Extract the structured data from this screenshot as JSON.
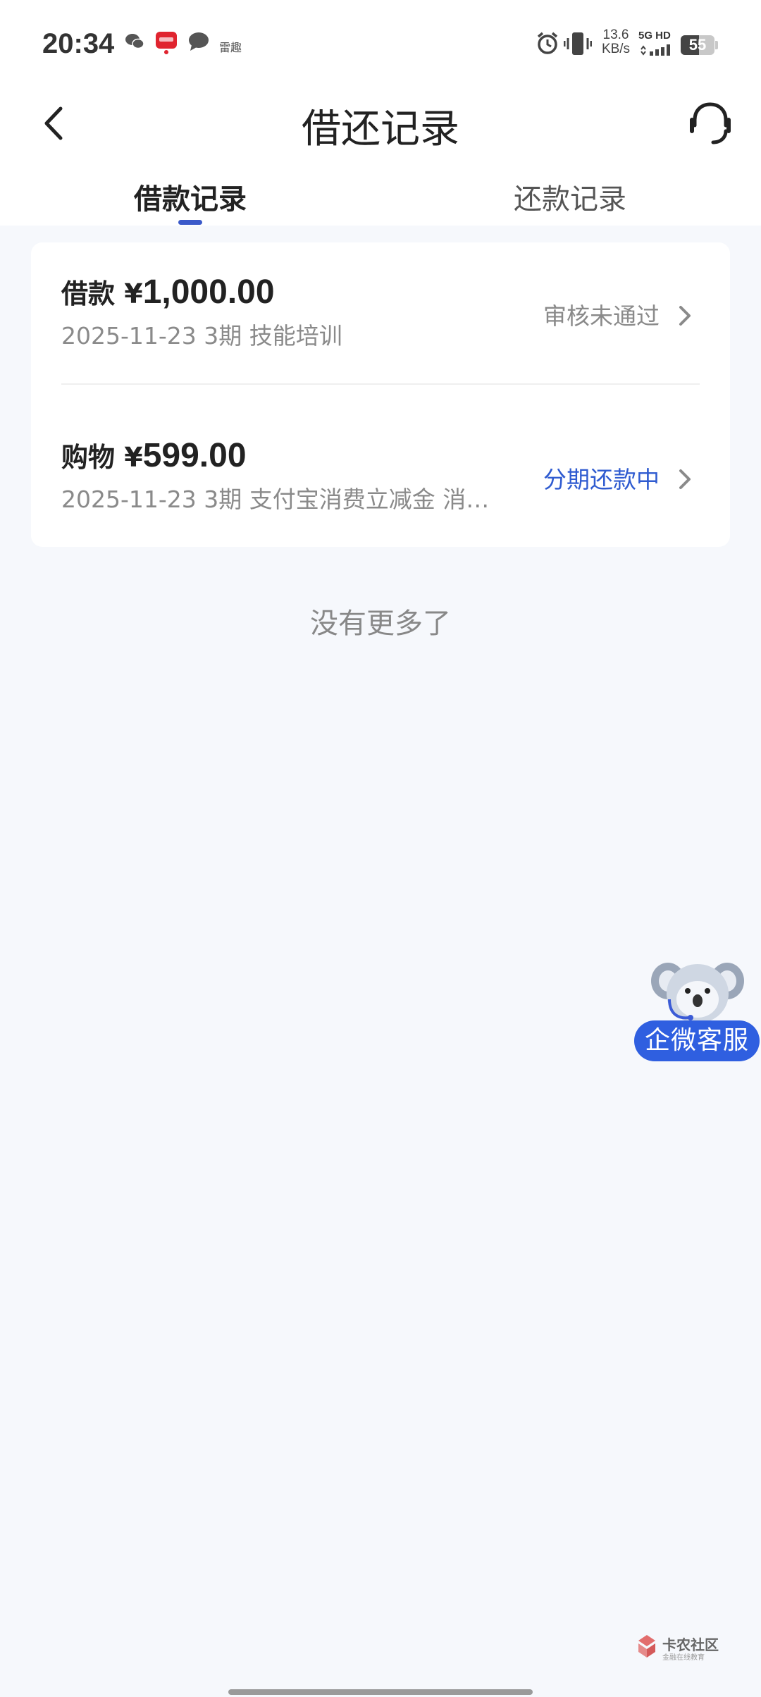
{
  "status_bar": {
    "time": "20:34",
    "notification_label": "雷趣",
    "net_speed_value": "13.6",
    "net_speed_unit": "KB/s",
    "network_type": "5G HD",
    "battery": "55"
  },
  "header": {
    "title": "借还记录",
    "back_icon": "back-arrow",
    "service_icon": "headset-icon"
  },
  "tabs": [
    {
      "label": "借款记录",
      "active": true
    },
    {
      "label": "还款记录",
      "active": false
    }
  ],
  "records": [
    {
      "type_label": "借款",
      "currency": "¥",
      "amount": "1,000.00",
      "subtitle": "2025-11-23 3期  技能培训",
      "status": "审核未通过",
      "status_color": "#8a8a8a"
    },
    {
      "type_label": "购物",
      "currency": "¥",
      "amount": "599.00",
      "subtitle": "2025-11-23 3期  支付宝消费立减金 消…",
      "status": "分期还款中",
      "status_color": "#2f5bd0"
    }
  ],
  "list_end_text": "没有更多了",
  "floating_service": {
    "label": "企微客服"
  },
  "watermark": {
    "title": "卡农社区",
    "subtitle": "金融在线教育"
  },
  "colors": {
    "accent": "#2f5fe0",
    "background": "#f6f8fc"
  }
}
